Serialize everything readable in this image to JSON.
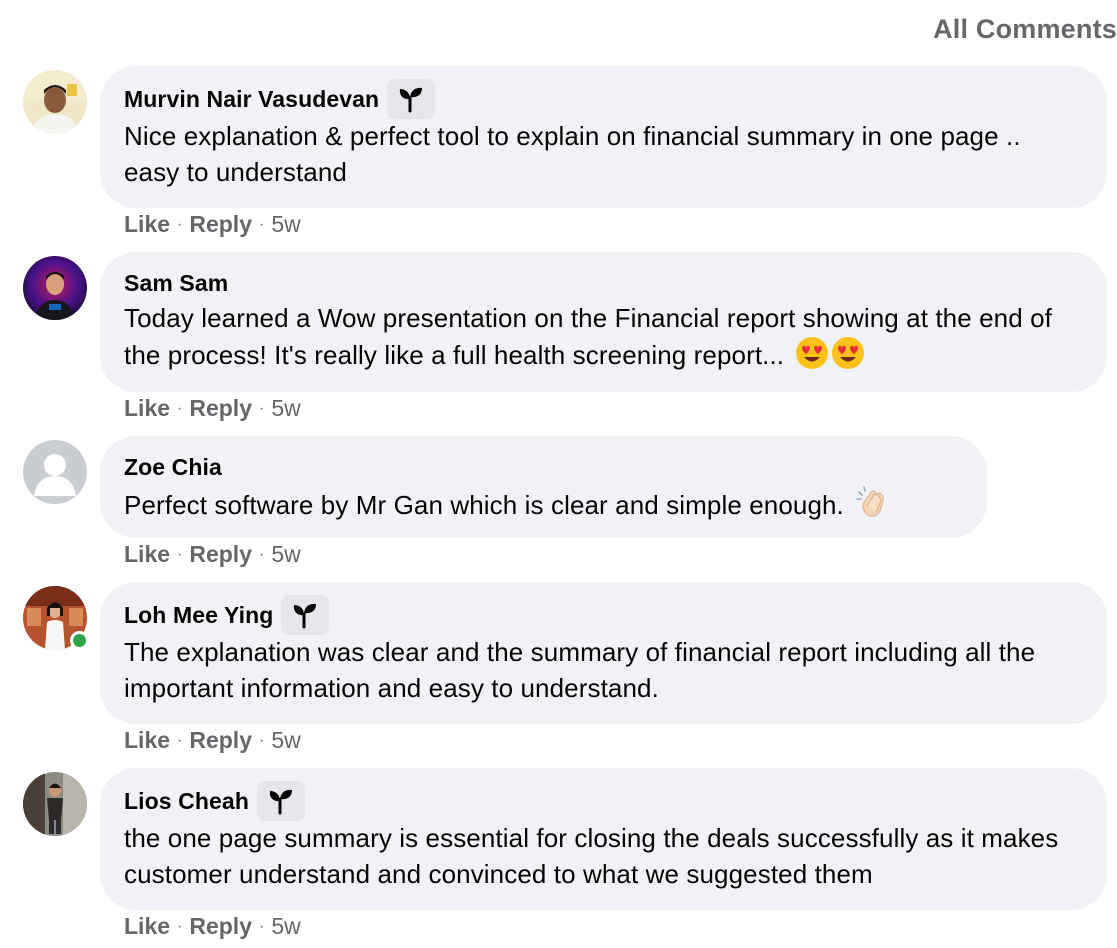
{
  "filter_label": "All Comments",
  "comments": [
    {
      "author": "Murvin Nair Vasudevan",
      "badge": "seedling",
      "text": "Nice explanation & perfect tool to explain on financial summary in one page .. easy to understand",
      "like": "Like",
      "reply": "Reply",
      "time": "5w"
    },
    {
      "author": "Sam Sam",
      "text": "Today learned a Wow presentation on the Financial report showing at the end of the process! It's really like a full health screening report...",
      "emoji": [
        "heart-eyes-emoji",
        "heart-eyes-emoji"
      ],
      "like": "Like",
      "reply": "Reply",
      "time": "5w"
    },
    {
      "author": "Zoe Chia",
      "text": "Perfect software by Mr Gan which is clear and simple enough.",
      "emoji": [
        "clapping-hands-emoji"
      ],
      "like": "Like",
      "reply": "Reply",
      "time": "5w"
    },
    {
      "author": "Loh Mee Ying",
      "badge": "seedling",
      "online": true,
      "text": "The explanation was clear and the summary of financial report including all the important information and easy to understand.",
      "like": "Like",
      "reply": "Reply",
      "time": "5w"
    },
    {
      "author": "Lios Cheah",
      "badge": "seedling",
      "text": "the one page summary is essential for closing the deals successfully as it makes customer understand and convinced to what we suggested them",
      "like": "Like",
      "reply": "Reply",
      "time": "5w"
    }
  ],
  "colors": {
    "bubble": "#f0f2f5",
    "secondary_text": "#65676b",
    "online": "#31a24c"
  }
}
